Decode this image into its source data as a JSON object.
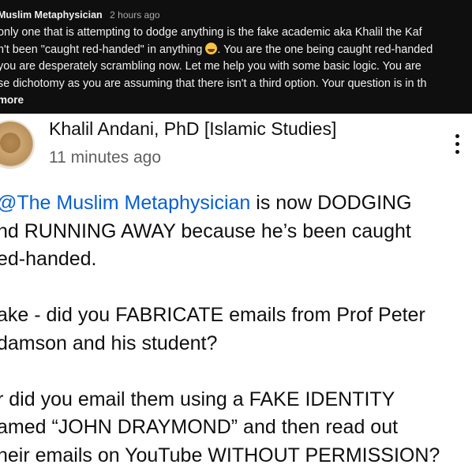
{
  "top_comment": {
    "author": "Muslim Metaphysician",
    "time": "2 hours ago",
    "lines": [
      "only one that is attempting to dodge anything is the fake academic aka Khalil the Kaf",
      "n't been \"caught red-handed\" in anything",
      ". You are the one being caught red-handed",
      "you are desperately scrambling now. Let me help you with some basic logic. You are",
      "se dichotomy as you are assuming that there isn't a third option. Your question is in th"
    ],
    "emoji": "laughing-face-emoji",
    "read_more": "more"
  },
  "main_comment": {
    "author": "Khalil Andani, PhD [Islamic Studies]",
    "time": "11 minutes ago",
    "mention": "@The Muslim Metaphysician",
    "line1_rest": " is now DODGING",
    "line2": "nd RUNNING AWAY because he’s been caught",
    "line3": "ed-handed.",
    "line4": "ake - did you FABRICATE emails from Prof Peter",
    "line5": "damson and his student?",
    "line6": "r did you email them using a FAKE IDENTITY",
    "line7": "amed “JOHN DRAYMOND” and then read out",
    "line8": "heir emails on YouTube WITHOUT PERMISSION?"
  },
  "colors": {
    "dark_bg": "#0f0f0f",
    "link": "#065fd4",
    "secondary_text": "#606060"
  }
}
